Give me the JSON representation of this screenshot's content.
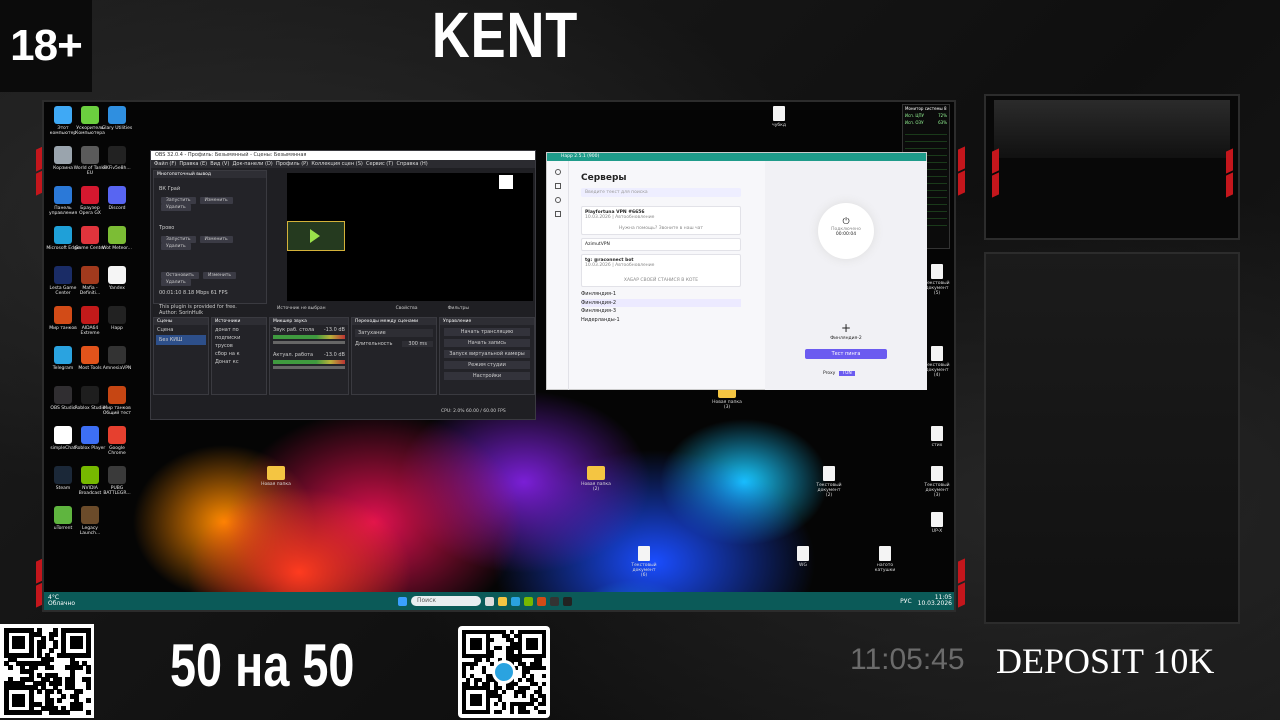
{
  "overlay": {
    "age_rating": "18+",
    "brand": "KENT",
    "promo": "50 на 50",
    "clock": "11:05:45",
    "deposit": "DEPOSIT 10K"
  },
  "desktop_icons": [
    {
      "label": "Этот компьютер",
      "color": "#3fa9f5"
    },
    {
      "label": "Ускоритель Компьютера",
      "color": "#6bcf3f"
    },
    {
      "label": "Glary Utilities",
      "color": "#2f8fe0"
    },
    {
      "label": "Корзина",
      "color": "#9aa4ad"
    },
    {
      "label": "World of Tanks EU",
      "color": "#5a5a5a"
    },
    {
      "label": "FKFiv5e8h...",
      "color": "#222222"
    },
    {
      "label": "Панель управления",
      "color": "#2b79d8"
    },
    {
      "label": "Браузер Opera GX",
      "color": "#d4182f"
    },
    {
      "label": "Discord",
      "color": "#5865f2"
    },
    {
      "label": "Microsoft Edge",
      "color": "#1fa0d8"
    },
    {
      "label": "Game Center",
      "color": "#e0343c"
    },
    {
      "label": "Wot Meteor...",
      "color": "#7cbd35"
    },
    {
      "label": "Lesta Game Center",
      "color": "#1a2c66"
    },
    {
      "label": "Mafia - Definiti...",
      "color": "#a23a1d"
    },
    {
      "label": "Yandex",
      "color": "#f5f5f5"
    },
    {
      "label": "Мир танков",
      "color": "#d24b17"
    },
    {
      "label": "AIDA64 Extreme",
      "color": "#c21a1a"
    },
    {
      "label": "Happ",
      "color": "#222222"
    },
    {
      "label": "Telegram",
      "color": "#2aa3e0"
    },
    {
      "label": "Most Tools",
      "color": "#e2531b"
    },
    {
      "label": "AmnesiaVPN",
      "color": "#333333"
    },
    {
      "label": "OBS Studio",
      "color": "#302e31"
    },
    {
      "label": "Roblox Studio",
      "color": "#1e1e1e"
    },
    {
      "label": "Мир танков Общий тест",
      "color": "#c64613"
    },
    {
      "label": "simpleChat",
      "color": "#ffffff"
    },
    {
      "label": "Roblox Player",
      "color": "#3d6ff5"
    },
    {
      "label": "Google Chrome",
      "color": "#e6402f"
    },
    {
      "label": "Steam",
      "color": "#1b2838"
    },
    {
      "label": "NVIDIA Broadcast",
      "color": "#76b900"
    },
    {
      "label": "PUBG BATTLEGR...",
      "color": "#3a3a3a"
    },
    {
      "label": "uTorrent",
      "color": "#5fb53f"
    },
    {
      "label": "Legacy Launch...",
      "color": "#6b4b2a"
    }
  ],
  "desktop_files": [
    {
      "label": "чубкд",
      "kind": "file"
    },
    {
      "label": "Текстовый документ (5)",
      "kind": "file"
    },
    {
      "label": "Текстовый документ (4)",
      "kind": "file"
    },
    {
      "label": "стих",
      "kind": "file"
    },
    {
      "label": "Текстовый документ (2)",
      "kind": "file"
    },
    {
      "label": "Текстовый документ (3)",
      "kind": "file"
    },
    {
      "label": "UP-X",
      "kind": "file"
    },
    {
      "label": "Новая папка",
      "kind": "folder"
    },
    {
      "label": "Новая папка (2)",
      "kind": "folder"
    },
    {
      "label": "Новая папка (3)",
      "kind": "folder"
    },
    {
      "label": "Текстовый документ (6)",
      "kind": "file"
    },
    {
      "label": "WG",
      "kind": "file"
    },
    {
      "label": "нагото катушки",
      "kind": "file"
    }
  ],
  "obs": {
    "title": "OBS 32.0.4 - Профиль: Безымянный - Сцены: Безымянная",
    "menu": [
      "Файл (F)",
      "Правка (E)",
      "Вид (V)",
      "Док-панели (D)",
      "Профиль (P)",
      "Коллекция сцен (S)",
      "Сервис (T)",
      "Справка (H)"
    ],
    "output_panel_title": "Многопоточный вывод",
    "outputs": [
      {
        "name": "ВК Грай",
        "btn_start": "Запустить",
        "btn_edit": "Изменить",
        "btn_delete": "Удалить"
      },
      {
        "name": "Трово",
        "btn_start": "Запустить",
        "btn_edit": "Изменить",
        "btn_delete": "Удалить"
      }
    ],
    "active_output": {
      "btn_stop": "Остановить",
      "btn_edit": "Изменить",
      "btn_delete": "Удалить",
      "stats": "00:01:10  8.18 Mbps  61 FPS"
    },
    "plugin_note": "This plugin is provided for free.",
    "author": "Author: SorinHulk",
    "source_none": "Источник не выбран",
    "props_btn": "Свойства",
    "filters_btn": "Фильтры",
    "scenes_title": "Сцены",
    "scenes": [
      "Сцена",
      "Без КИШ"
    ],
    "sources_title": "Источники",
    "sources": [
      "донат по",
      "подписки",
      "трусов",
      "сбор на к",
      "Донат кс"
    ],
    "mixer_title": "Микшер звука",
    "mixer": [
      {
        "name": "Звук раб. стола",
        "level": "-13.0 dB"
      },
      {
        "name": "Актуал. работа",
        "level": "-13.0 dB"
      }
    ],
    "transitions_title": "Переходы между сценами",
    "transition": "Затухание",
    "duration_label": "Длительность",
    "duration": "300 ms",
    "controls_title": "Управление",
    "controls": [
      "Начать трансляцию",
      "Начать запись",
      "Запуск виртуальной камеры",
      "Режим студии",
      "Настройки"
    ],
    "status": "CPU: 2.0%  60.00 / 60.00 FPS"
  },
  "happ": {
    "title": "Happ 2.5.1 (900)",
    "heading": "Серверы",
    "search_placeholder": "Введите текст для поиска",
    "servers": [
      {
        "name": "Playfortuna VPN #6656",
        "meta": "10.03.2026 | Автообновление",
        "extra": "Нужна помощь? Звоните в наш чат"
      },
      {
        "name": "AzimutVPN",
        "meta": "",
        "extra": ""
      },
      {
        "name": "tg: @raconnect bot",
        "meta": "10.03.2026 | Автообновление",
        "extra": "ХАБАР СВОЕЙ СТАНИСЯ В КОТЕ"
      }
    ],
    "locations": [
      "Финляндия-1",
      "Финляндия-2",
      "Финляндия-3",
      "Нидерланды-1"
    ],
    "timer_label": "Подключено",
    "timer": "00:00:04",
    "selected_location": "Финляндия-2",
    "test_button": "Тест пинга",
    "proxy_label": "Proxy",
    "mode_label": "TUN"
  },
  "taskbar": {
    "weather_temp": "4°C",
    "weather_desc": "Облачно",
    "search_placeholder": "Поиск",
    "lang": "РУС",
    "time": "11:05",
    "date": "10.03.2026"
  },
  "sysmon": {
    "title": "Монитор системы 8",
    "cpu_label": "Исп. ЦПУ",
    "cpu_value": "72%",
    "ram_label": "Исп. ОЗУ",
    "ram_value": "63%"
  }
}
